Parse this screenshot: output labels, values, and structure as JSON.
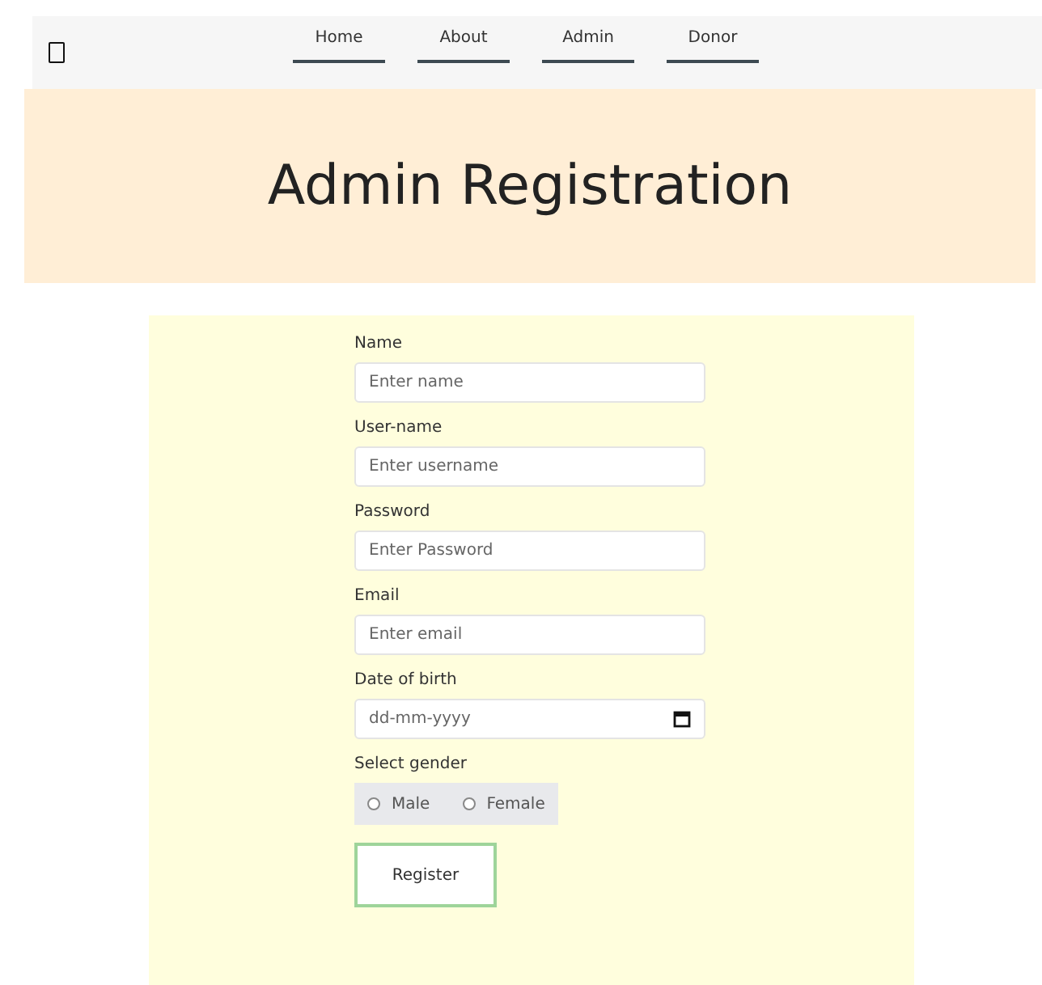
{
  "nav": {
    "links": [
      {
        "label": "Home"
      },
      {
        "label": "About"
      },
      {
        "label": "Admin"
      },
      {
        "label": "Donor"
      }
    ]
  },
  "header": {
    "title": "Admin Registration"
  },
  "form": {
    "fields": [
      {
        "kind": "text",
        "label": "Name",
        "placeholder": "Enter name"
      },
      {
        "kind": "text",
        "label": "User-name",
        "placeholder": "Enter username"
      },
      {
        "kind": "text",
        "label": "Password",
        "placeholder": "Enter Password"
      },
      {
        "kind": "text",
        "label": "Email",
        "placeholder": "Enter email"
      },
      {
        "kind": "date",
        "label": "Date of birth",
        "placeholder": "dd-mm-yyyy"
      }
    ],
    "gender": {
      "label": "Select gender",
      "options": [
        {
          "label": "Male",
          "selected": false
        },
        {
          "label": "Female",
          "selected": false
        }
      ]
    },
    "submit": "Register"
  }
}
